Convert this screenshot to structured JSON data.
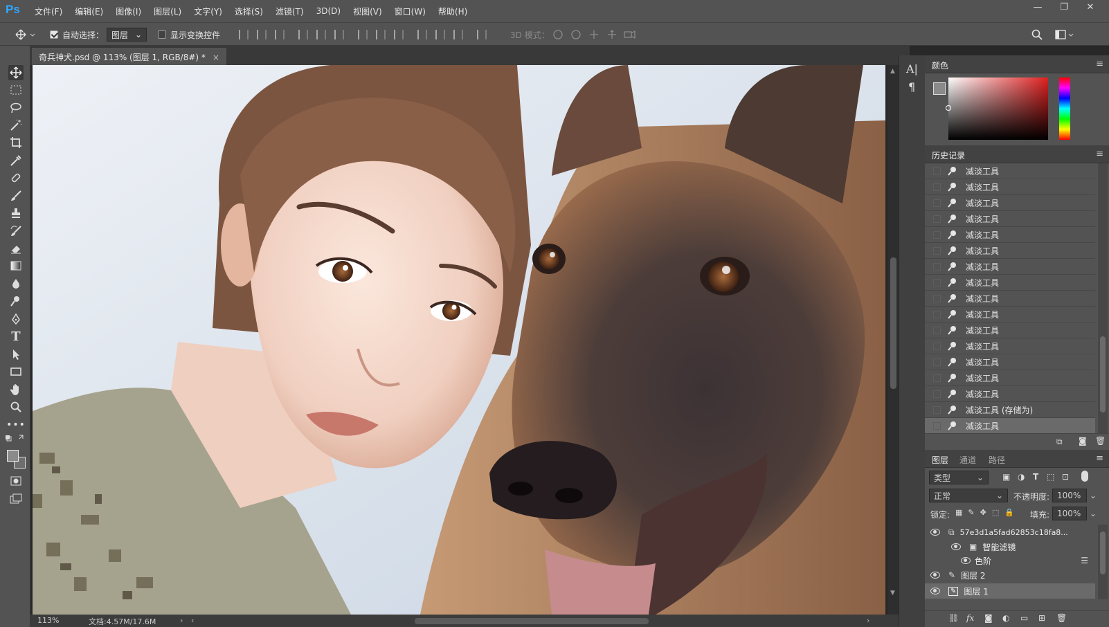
{
  "app": {
    "logo": "Ps"
  },
  "menu": [
    "文件(F)",
    "编辑(E)",
    "图像(I)",
    "图层(L)",
    "文字(Y)",
    "选择(S)",
    "滤镜(T)",
    "3D(D)",
    "视图(V)",
    "窗口(W)",
    "帮助(H)"
  ],
  "window_controls": {
    "minimize": "—",
    "restore": "❐",
    "close": "✕"
  },
  "options_bar": {
    "auto_select_label": "自动选择：",
    "auto_select_checked": true,
    "auto_select_target": "图层",
    "show_transform_label": "显示变换控件",
    "show_transform_checked": false,
    "mode3d_label": "3D 模式："
  },
  "document": {
    "tab_title": "奇兵神犬.psd @ 113% (图层 1, RGB/8#) *",
    "zoom": "113%",
    "doc_size": "文档:4.57M/17.6M"
  },
  "color_panel": {
    "title": "颜色",
    "fg": "#8a8a8a",
    "bg": "#707070"
  },
  "history_panel": {
    "title": "历史记录",
    "items": [
      {
        "label": "减淡工具"
      },
      {
        "label": "减淡工具"
      },
      {
        "label": "减淡工具"
      },
      {
        "label": "减淡工具"
      },
      {
        "label": "减淡工具"
      },
      {
        "label": "减淡工具"
      },
      {
        "label": "减淡工具"
      },
      {
        "label": "减淡工具"
      },
      {
        "label": "减淡工具"
      },
      {
        "label": "减淡工具"
      },
      {
        "label": "减淡工具"
      },
      {
        "label": "减淡工具"
      },
      {
        "label": "减淡工具"
      },
      {
        "label": "减淡工具"
      },
      {
        "label": "减淡工具"
      },
      {
        "label": "减淡工具 (存储为)"
      },
      {
        "label": "减淡工具"
      }
    ],
    "selected_index": 16
  },
  "layers_panel": {
    "tabs": [
      "图层",
      "通道",
      "路径"
    ],
    "active_tab": 0,
    "filter_kind": "类型",
    "blend_mode": "正常",
    "opacity_label": "不透明度:",
    "opacity_value": "100%",
    "lock_label": "锁定:",
    "fill_label": "填充:",
    "fill_value": "100%",
    "layers": [
      {
        "name": "57e3d1a5fad62853c18fa8..."
      },
      {
        "name": "智能滤镜"
      },
      {
        "name": "色阶"
      },
      {
        "name": "图层 2"
      },
      {
        "name": "图层 1"
      }
    ],
    "selected_layer": 4
  }
}
